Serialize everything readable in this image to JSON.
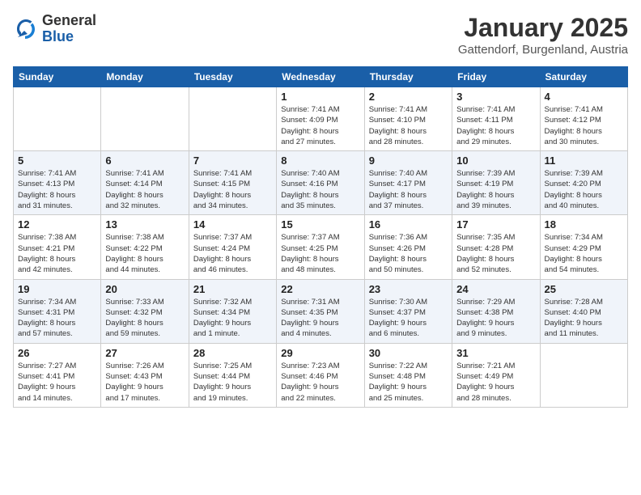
{
  "logo": {
    "general": "General",
    "blue": "Blue"
  },
  "title": "January 2025",
  "location": "Gattendorf, Burgenland, Austria",
  "weekdays": [
    "Sunday",
    "Monday",
    "Tuesday",
    "Wednesday",
    "Thursday",
    "Friday",
    "Saturday"
  ],
  "weeks": [
    [
      {
        "day": "",
        "info": ""
      },
      {
        "day": "",
        "info": ""
      },
      {
        "day": "",
        "info": ""
      },
      {
        "day": "1",
        "info": "Sunrise: 7:41 AM\nSunset: 4:09 PM\nDaylight: 8 hours\nand 27 minutes."
      },
      {
        "day": "2",
        "info": "Sunrise: 7:41 AM\nSunset: 4:10 PM\nDaylight: 8 hours\nand 28 minutes."
      },
      {
        "day": "3",
        "info": "Sunrise: 7:41 AM\nSunset: 4:11 PM\nDaylight: 8 hours\nand 29 minutes."
      },
      {
        "day": "4",
        "info": "Sunrise: 7:41 AM\nSunset: 4:12 PM\nDaylight: 8 hours\nand 30 minutes."
      }
    ],
    [
      {
        "day": "5",
        "info": "Sunrise: 7:41 AM\nSunset: 4:13 PM\nDaylight: 8 hours\nand 31 minutes."
      },
      {
        "day": "6",
        "info": "Sunrise: 7:41 AM\nSunset: 4:14 PM\nDaylight: 8 hours\nand 32 minutes."
      },
      {
        "day": "7",
        "info": "Sunrise: 7:41 AM\nSunset: 4:15 PM\nDaylight: 8 hours\nand 34 minutes."
      },
      {
        "day": "8",
        "info": "Sunrise: 7:40 AM\nSunset: 4:16 PM\nDaylight: 8 hours\nand 35 minutes."
      },
      {
        "day": "9",
        "info": "Sunrise: 7:40 AM\nSunset: 4:17 PM\nDaylight: 8 hours\nand 37 minutes."
      },
      {
        "day": "10",
        "info": "Sunrise: 7:39 AM\nSunset: 4:19 PM\nDaylight: 8 hours\nand 39 minutes."
      },
      {
        "day": "11",
        "info": "Sunrise: 7:39 AM\nSunset: 4:20 PM\nDaylight: 8 hours\nand 40 minutes."
      }
    ],
    [
      {
        "day": "12",
        "info": "Sunrise: 7:38 AM\nSunset: 4:21 PM\nDaylight: 8 hours\nand 42 minutes."
      },
      {
        "day": "13",
        "info": "Sunrise: 7:38 AM\nSunset: 4:22 PM\nDaylight: 8 hours\nand 44 minutes."
      },
      {
        "day": "14",
        "info": "Sunrise: 7:37 AM\nSunset: 4:24 PM\nDaylight: 8 hours\nand 46 minutes."
      },
      {
        "day": "15",
        "info": "Sunrise: 7:37 AM\nSunset: 4:25 PM\nDaylight: 8 hours\nand 48 minutes."
      },
      {
        "day": "16",
        "info": "Sunrise: 7:36 AM\nSunset: 4:26 PM\nDaylight: 8 hours\nand 50 minutes."
      },
      {
        "day": "17",
        "info": "Sunrise: 7:35 AM\nSunset: 4:28 PM\nDaylight: 8 hours\nand 52 minutes."
      },
      {
        "day": "18",
        "info": "Sunrise: 7:34 AM\nSunset: 4:29 PM\nDaylight: 8 hours\nand 54 minutes."
      }
    ],
    [
      {
        "day": "19",
        "info": "Sunrise: 7:34 AM\nSunset: 4:31 PM\nDaylight: 8 hours\nand 57 minutes."
      },
      {
        "day": "20",
        "info": "Sunrise: 7:33 AM\nSunset: 4:32 PM\nDaylight: 8 hours\nand 59 minutes."
      },
      {
        "day": "21",
        "info": "Sunrise: 7:32 AM\nSunset: 4:34 PM\nDaylight: 9 hours\nand 1 minute."
      },
      {
        "day": "22",
        "info": "Sunrise: 7:31 AM\nSunset: 4:35 PM\nDaylight: 9 hours\nand 4 minutes."
      },
      {
        "day": "23",
        "info": "Sunrise: 7:30 AM\nSunset: 4:37 PM\nDaylight: 9 hours\nand 6 minutes."
      },
      {
        "day": "24",
        "info": "Sunrise: 7:29 AM\nSunset: 4:38 PM\nDaylight: 9 hours\nand 9 minutes."
      },
      {
        "day": "25",
        "info": "Sunrise: 7:28 AM\nSunset: 4:40 PM\nDaylight: 9 hours\nand 11 minutes."
      }
    ],
    [
      {
        "day": "26",
        "info": "Sunrise: 7:27 AM\nSunset: 4:41 PM\nDaylight: 9 hours\nand 14 minutes."
      },
      {
        "day": "27",
        "info": "Sunrise: 7:26 AM\nSunset: 4:43 PM\nDaylight: 9 hours\nand 17 minutes."
      },
      {
        "day": "28",
        "info": "Sunrise: 7:25 AM\nSunset: 4:44 PM\nDaylight: 9 hours\nand 19 minutes."
      },
      {
        "day": "29",
        "info": "Sunrise: 7:23 AM\nSunset: 4:46 PM\nDaylight: 9 hours\nand 22 minutes."
      },
      {
        "day": "30",
        "info": "Sunrise: 7:22 AM\nSunset: 4:48 PM\nDaylight: 9 hours\nand 25 minutes."
      },
      {
        "day": "31",
        "info": "Sunrise: 7:21 AM\nSunset: 4:49 PM\nDaylight: 9 hours\nand 28 minutes."
      },
      {
        "day": "",
        "info": ""
      }
    ]
  ]
}
